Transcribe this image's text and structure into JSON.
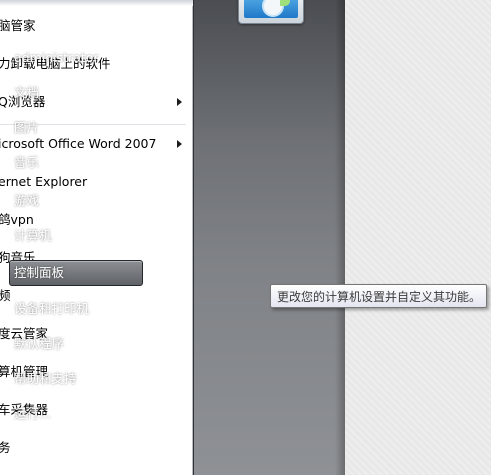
{
  "programs": {
    "items": [
      {
        "label": "脑管家",
        "has_submenu": false
      },
      {
        "label": "力卸载电脑上的软件",
        "has_submenu": false
      },
      {
        "label": "Q浏览器",
        "has_submenu": true
      },
      {
        "label": "icrosoft Office Word 2007",
        "has_submenu": true
      },
      {
        "label": "ernet Explorer",
        "has_submenu": false
      },
      {
        "label": "鸽vpn",
        "has_submenu": false
      },
      {
        "label": "狗音乐",
        "has_submenu": false
      },
      {
        "label": "频",
        "has_submenu": false
      },
      {
        "label": "度云管家",
        "has_submenu": false
      },
      {
        "label": "算机管理",
        "has_submenu": false
      },
      {
        "label": "车采集器",
        "has_submenu": false
      },
      {
        "label": "务",
        "has_submenu": false
      }
    ]
  },
  "places": {
    "user_name": "administrator",
    "items": [
      {
        "label": "文档",
        "hover": false
      },
      {
        "label": "图片",
        "hover": false
      },
      {
        "label": "音乐",
        "hover": false
      },
      {
        "label": "游戏",
        "hover": false
      },
      {
        "label": "计算机",
        "hover": false
      },
      {
        "label": "控制面板",
        "hover": true
      },
      {
        "label": "设备和打印机",
        "hover": false
      },
      {
        "label": "默认程序",
        "hover": false
      },
      {
        "label": "帮助和支持",
        "hover": false
      },
      {
        "label": "运行...",
        "hover": false
      }
    ]
  },
  "tooltip": {
    "text": "更改您的计算机设置并自定义其功能。"
  }
}
